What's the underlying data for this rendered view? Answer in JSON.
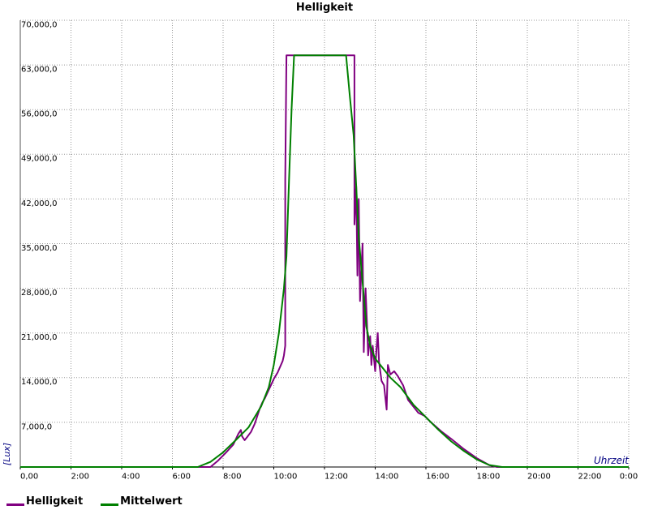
{
  "chart_data": {
    "type": "line",
    "title": "Helligkeit",
    "xlabel": "Uhrzeit",
    "ylabel": "[Lux]",
    "xlim": [
      0,
      24
    ],
    "ylim": [
      0,
      70000
    ],
    "x_ticks": [
      0,
      2,
      4,
      6,
      8,
      10,
      12,
      14,
      16,
      18,
      20,
      22,
      24
    ],
    "x_tick_labels": [
      "0,00",
      "2:00",
      "4:00",
      "6:00",
      "8:00",
      "10:00",
      "12:00",
      "14:00",
      "16:00",
      "18:00",
      "20:00",
      "22:00",
      "0:00"
    ],
    "y_ticks": [
      7000,
      14000,
      21000,
      28000,
      35000,
      42000,
      49000,
      56000,
      63000,
      70000
    ],
    "y_tick_labels": [
      "7,000,0",
      "14,000,0",
      "21,000,0",
      "28,000,0",
      "35,000,0",
      "42,000,0",
      "49,000,0",
      "56,000,0",
      "63,000,0",
      "70,000,0"
    ],
    "grid": true,
    "legend_position": "bottom-left",
    "series": [
      {
        "name": "Helligkeit",
        "color": "#800080",
        "points": [
          [
            0,
            0
          ],
          [
            7.5,
            0
          ],
          [
            7.8,
            1000
          ],
          [
            8.1,
            2200
          ],
          [
            8.4,
            3500
          ],
          [
            8.6,
            5200
          ],
          [
            8.7,
            5800
          ],
          [
            8.75,
            4800
          ],
          [
            8.85,
            4200
          ],
          [
            8.95,
            4700
          ],
          [
            9.1,
            5500
          ],
          [
            9.25,
            6800
          ],
          [
            9.45,
            9200
          ],
          [
            9.55,
            10100
          ],
          [
            9.65,
            10800
          ],
          [
            9.8,
            12100
          ],
          [
            10.0,
            13800
          ],
          [
            10.15,
            14800
          ],
          [
            10.35,
            16600
          ],
          [
            10.4,
            17500
          ],
          [
            10.45,
            19000
          ],
          [
            10.45,
            45000
          ],
          [
            10.5,
            64500
          ],
          [
            11.8,
            64500
          ],
          [
            13.18,
            64500
          ],
          [
            13.18,
            38000
          ],
          [
            13.25,
            44000
          ],
          [
            13.3,
            30000
          ],
          [
            13.35,
            42000
          ],
          [
            13.4,
            26000
          ],
          [
            13.5,
            35000
          ],
          [
            13.55,
            18000
          ],
          [
            13.62,
            28000
          ],
          [
            13.68,
            22000
          ],
          [
            13.72,
            17500
          ],
          [
            13.8,
            20500
          ],
          [
            13.85,
            16000
          ],
          [
            13.9,
            19000
          ],
          [
            14.0,
            15000
          ],
          [
            14.05,
            18500
          ],
          [
            14.1,
            21000
          ],
          [
            14.15,
            16500
          ],
          [
            14.25,
            13500
          ],
          [
            14.35,
            12800
          ],
          [
            14.45,
            9000
          ],
          [
            14.5,
            16000
          ],
          [
            14.6,
            14500
          ],
          [
            14.75,
            15000
          ],
          [
            14.9,
            14200
          ],
          [
            15.1,
            12800
          ],
          [
            15.3,
            10500
          ],
          [
            15.5,
            9500
          ],
          [
            15.7,
            8500
          ],
          [
            15.95,
            8000
          ],
          [
            16.2,
            7000
          ],
          [
            16.6,
            5600
          ],
          [
            17.0,
            4400
          ],
          [
            17.5,
            2800
          ],
          [
            18.0,
            1400
          ],
          [
            18.5,
            300
          ],
          [
            18.8,
            0
          ],
          [
            24,
            0
          ]
        ]
      },
      {
        "name": "Mittelwert",
        "color": "#008000",
        "points": [
          [
            0,
            0
          ],
          [
            7.0,
            0
          ],
          [
            7.5,
            800
          ],
          [
            8.0,
            2300
          ],
          [
            8.5,
            4200
          ],
          [
            9.0,
            6200
          ],
          [
            9.5,
            9500
          ],
          [
            9.8,
            12500
          ],
          [
            10.0,
            16000
          ],
          [
            10.2,
            21000
          ],
          [
            10.4,
            28000
          ],
          [
            10.5,
            33000
          ],
          [
            10.6,
            45000
          ],
          [
            10.7,
            56000
          ],
          [
            10.8,
            64500
          ],
          [
            11.5,
            64500
          ],
          [
            12.85,
            64500
          ],
          [
            13.0,
            58000
          ],
          [
            13.15,
            52000
          ],
          [
            13.25,
            44000
          ],
          [
            13.35,
            36000
          ],
          [
            13.5,
            29000
          ],
          [
            13.65,
            22000
          ],
          [
            13.8,
            19000
          ],
          [
            14.0,
            17000
          ],
          [
            14.3,
            15500
          ],
          [
            14.6,
            14000
          ],
          [
            15.0,
            12500
          ],
          [
            15.5,
            9800
          ],
          [
            16.0,
            7800
          ],
          [
            16.5,
            5800
          ],
          [
            17.0,
            4000
          ],
          [
            17.5,
            2500
          ],
          [
            18.0,
            1200
          ],
          [
            18.5,
            300
          ],
          [
            19.0,
            0
          ],
          [
            24,
            0
          ]
        ]
      }
    ]
  }
}
